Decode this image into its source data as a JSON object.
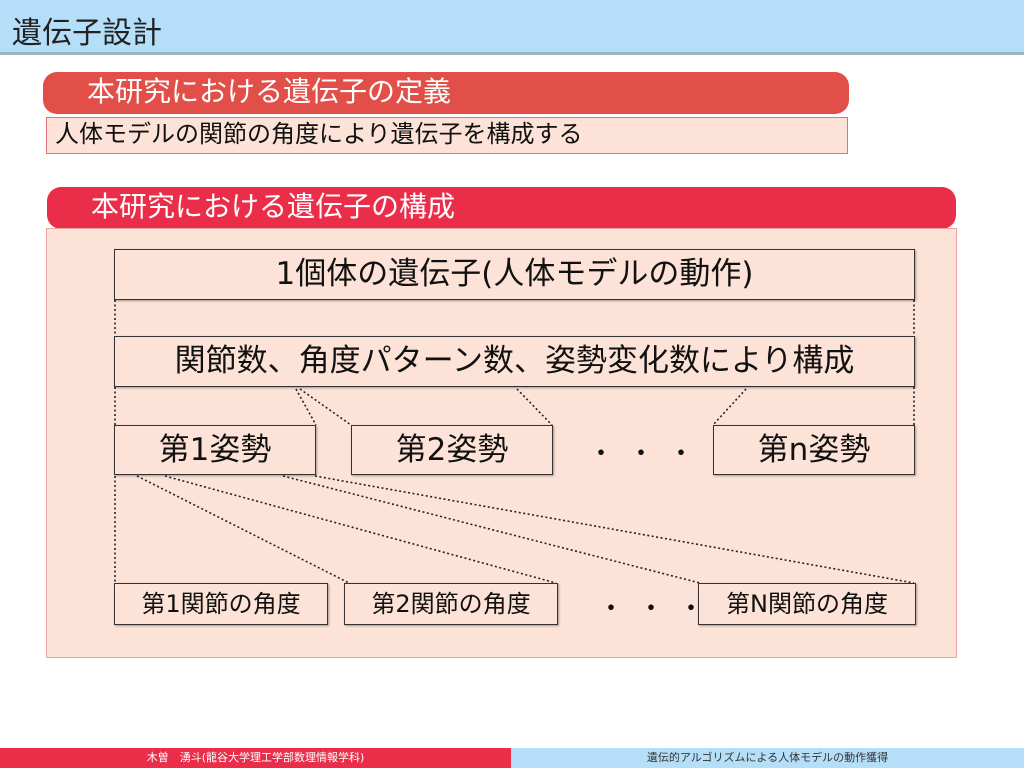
{
  "slide": {
    "title": "遺伝子設計"
  },
  "definition": {
    "heading": "本研究における遺伝子の定義",
    "text": "人体モデルの関節の角度により遺伝子を構成する"
  },
  "composition": {
    "heading": "本研究における遺伝子の構成",
    "individual": "1個体の遺伝子(人体モデルの動作)",
    "components": "関節数、角度パターン数、姿勢変化数により構成",
    "poses": [
      "第1姿勢",
      "第2姿勢",
      "第n姿勢"
    ],
    "pose_ellipsis": "・・・",
    "joints": [
      "第1関節の角度",
      "第2関節の角度",
      "第N関節の角度"
    ],
    "joint_ellipsis": "・・・"
  },
  "footer": {
    "left": "木曽　湧斗(龍谷大学理工学部数理情報学科)",
    "right": "遺伝的アルゴリズムによる人体モデルの動作獲得"
  }
}
